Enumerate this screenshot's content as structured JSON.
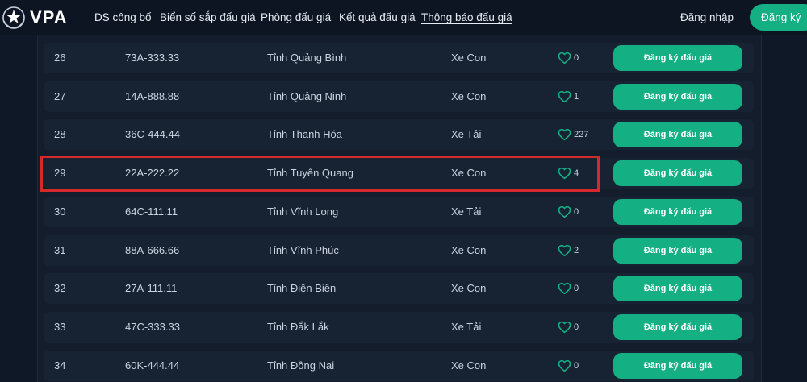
{
  "header": {
    "brand": "VPA",
    "nav": [
      {
        "label": "DS công bố",
        "active": false
      },
      {
        "label": "Biển số sắp đấu giá",
        "active": false
      },
      {
        "label": "Phòng đấu giá",
        "active": false
      },
      {
        "label": "Kết quả đấu giá",
        "active": false
      },
      {
        "label": "Thông báo đấu giá",
        "active": true
      }
    ],
    "login_label": "Đăng nhập",
    "register_label": "Đăng ký"
  },
  "rows": [
    {
      "stt": "26",
      "plate": "73A-333.33",
      "province": "Tỉnh Quảng Bình",
      "type": "Xe Con",
      "likes": "0",
      "button": "Đăng ký đấu giá"
    },
    {
      "stt": "27",
      "plate": "14A-888.88",
      "province": "Tỉnh Quảng Ninh",
      "type": "Xe Con",
      "likes": "1",
      "button": "Đăng ký đấu giá"
    },
    {
      "stt": "28",
      "plate": "36C-444.44",
      "province": "Tỉnh Thanh Hóa",
      "type": "Xe Tải",
      "likes": "227",
      "button": "Đăng ký đấu giá"
    },
    {
      "stt": "29",
      "plate": "22A-222.22",
      "province": "Tỉnh Tuyên Quang",
      "type": "Xe Con",
      "likes": "4",
      "button": "Đăng ký đấu giá"
    },
    {
      "stt": "30",
      "plate": "64C-111.11",
      "province": "Tỉnh Vĩnh Long",
      "type": "Xe Tải",
      "likes": "0",
      "button": "Đăng ký đấu giá"
    },
    {
      "stt": "31",
      "plate": "88A-666.66",
      "province": "Tỉnh Vĩnh Phúc",
      "type": "Xe Con",
      "likes": "2",
      "button": "Đăng ký đấu giá"
    },
    {
      "stt": "32",
      "plate": "27A-111.11",
      "province": "Tỉnh Điện Biên",
      "type": "Xe Con",
      "likes": "0",
      "button": "Đăng ký đấu giá"
    },
    {
      "stt": "33",
      "plate": "47C-333.33",
      "province": "Tỉnh Đắk Lắk",
      "type": "Xe Tải",
      "likes": "0",
      "button": "Đăng ký đấu giá"
    },
    {
      "stt": "34",
      "plate": "60K-444.44",
      "province": "Tỉnh Đồng Nai",
      "type": "Xe Con",
      "likes": "0",
      "button": "Đăng ký đấu giá"
    }
  ],
  "highlighted_row": "29",
  "colors": {
    "accent": "#14b083",
    "background": "#0f1826",
    "row_background": "#172233",
    "highlight": "#d42a2a"
  },
  "icons": {
    "like": "heart-outline-icon",
    "logo": "vpa-emblem-icon"
  }
}
